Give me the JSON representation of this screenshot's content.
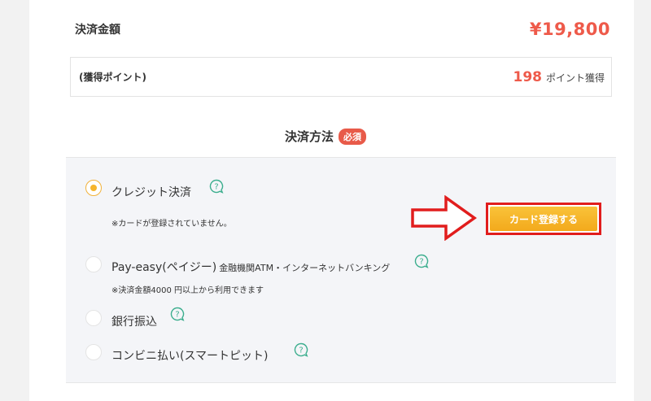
{
  "summary": {
    "total_label": "決済金額",
    "total_value": "¥19,800",
    "points_label": "(獲得ポイント)",
    "points_value": "198",
    "points_unit": "ポイント獲得"
  },
  "payment": {
    "title": "決済方法",
    "required_badge": "必須",
    "options": [
      {
        "label": "クレジット決済",
        "sub": "",
        "selected": true,
        "note": "※カードが登録されていません。"
      },
      {
        "label": "Pay-easy(ペイジー)",
        "sub": "金融機関ATM・インターネットバンキング",
        "selected": false,
        "note": "※決済金額4000 円以上から利用できます"
      },
      {
        "label": "銀行振込",
        "sub": "",
        "selected": false,
        "note": ""
      },
      {
        "label": "コンビニ払い(スマートピット)",
        "sub": "",
        "selected": false,
        "note": ""
      }
    ],
    "register_card_button": "カード登録する"
  },
  "colors": {
    "accent_red": "#ee5a4a",
    "radio_selected": "#f6b52d",
    "button": "#f3a91c",
    "highlight_border": "#e11d1d",
    "help_icon": "#3cae8e"
  },
  "icons": [
    "help-icon",
    "right-arrow-icon"
  ]
}
